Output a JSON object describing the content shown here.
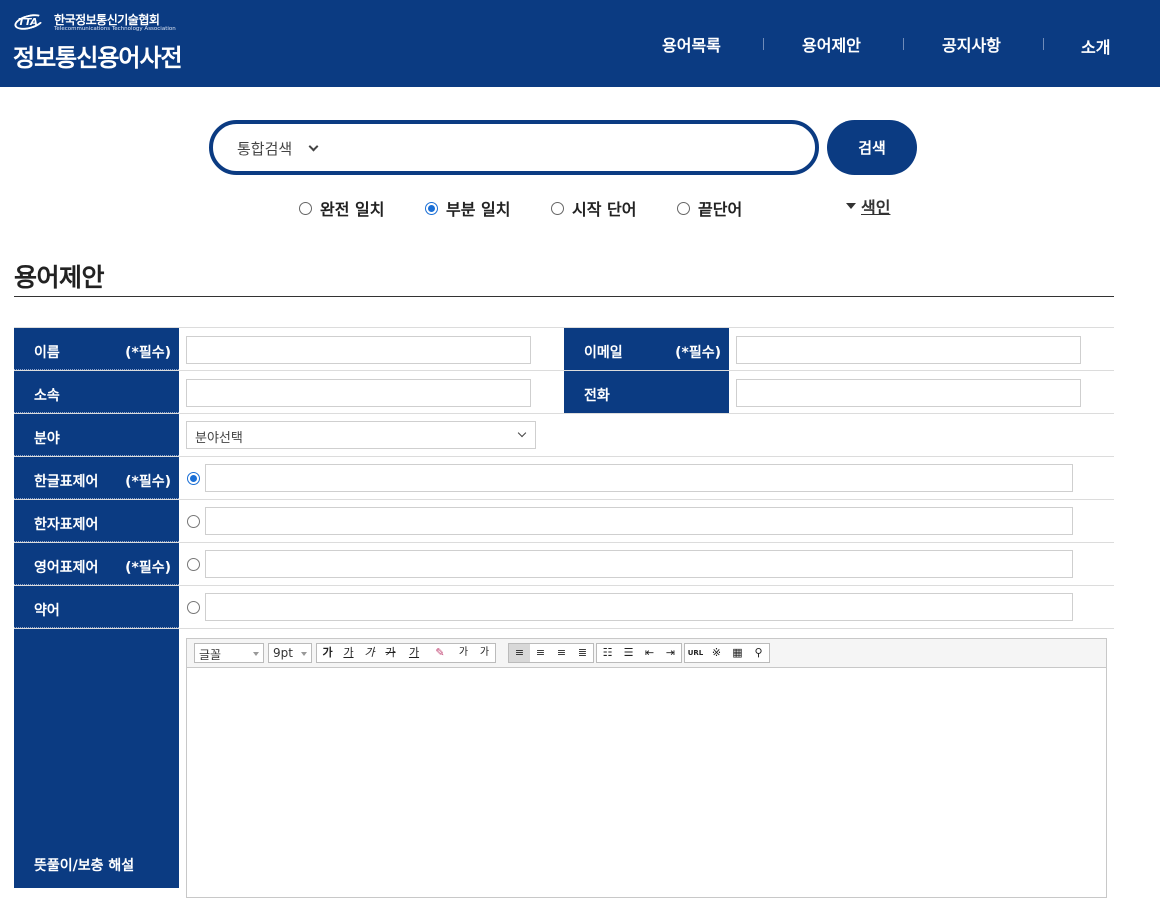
{
  "header": {
    "org_kr": "한국정보통신기술협회",
    "org_en": "Telecommunications Technology Association",
    "logo_text": "TTA",
    "site_title": "정보통신용어사전",
    "nav": [
      "용어목록",
      "용어제안",
      "공지사항",
      "소개"
    ]
  },
  "search": {
    "scope": "통합검색",
    "query": "",
    "button": "검색",
    "options": [
      {
        "label": "완전 일치",
        "selected": false
      },
      {
        "label": "부분 일치",
        "selected": true
      },
      {
        "label": "시작 단어",
        "selected": false
      },
      {
        "label": "끝단어",
        "selected": false
      }
    ],
    "index_label": "색인"
  },
  "page": {
    "title": "용어제안"
  },
  "form": {
    "name_label": "이름",
    "email_label": "이메일",
    "affiliation_label": "소속",
    "phone_label": "전화",
    "field_label": "분야",
    "field_value": "분야선택",
    "korean_label": "한글표제어",
    "hanja_label": "한자표제어",
    "english_label": "영어표제어",
    "abbr_label": "약어",
    "explanation_label": "뜻풀이/보충 해설",
    "required": "(*필수)"
  },
  "editor": {
    "font": "글꼴",
    "size": "9pt",
    "buttons": [
      "가",
      "가",
      "가",
      "가",
      "가",
      "가",
      "가",
      "가",
      "URL",
      "※"
    ],
    "superscript": "가",
    "subscript": "가"
  },
  "colors": {
    "brand": "#0b3b82",
    "radio": "#1a6fd6"
  }
}
